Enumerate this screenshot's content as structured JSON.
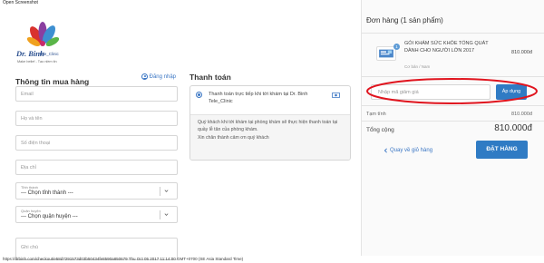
{
  "browser": {
    "caption": "Open Screenshot",
    "status_url": "https://drbinh.com/checkout/e58d7291573d03b50434fe8590a850679 Thu Oct 05 2017 11:14:00 GMT+0700 (SE Asia Standard Time)"
  },
  "brand": {
    "name": "Dr. Binh",
    "sub": "Tele_Clinic",
    "tagline": "Make belief - Tạo niềm tin",
    "logo_icon": "flower-petals-logo-icon"
  },
  "customer_info": {
    "title": "Thông tin mua hàng",
    "login_label": "Đăng nhập",
    "login_icon": "user-circle-icon",
    "fields": {
      "email_placeholder": "Email",
      "name_placeholder": "Họ và tên",
      "phone_placeholder": "Số điện thoại",
      "address_placeholder": "Địa chỉ",
      "note_placeholder": "Ghi chú"
    },
    "province": {
      "label": "Tỉnh thành",
      "value": "--- Chọn tỉnh thành ---"
    },
    "district": {
      "label": "Quận huyện",
      "value": "--- Chọn quận huyện ---"
    }
  },
  "payment": {
    "title": "Thanh toán",
    "option_label": "Thanh toán trực tiếp khi tới khám tại Dr. Binh Tele_Clinic",
    "option_icon": "cash-icon",
    "description_1": "Quý khách khi tới khám tại phòng khám sẽ thực hiện thanh toán tại quầy lễ tân của phòng khám.",
    "description_2": "Xin chân thành cảm ơn quý khách"
  },
  "order_summary": {
    "title": "Đơn hàng (1 sản phẩm)",
    "item": {
      "quantity": "1",
      "name": "GÓI KHÁM SỨC KHỎE TỔNG QUÁT DÀNH CHO NGƯỜI LỚN 2017",
      "variant": "Cơ bản / Nam",
      "price": "810.000đ"
    },
    "discount_placeholder": "Nhập mã giảm giá",
    "apply_label": "Áp dụng",
    "subtotal_label": "Tạm tính",
    "subtotal_value": "810.000đ",
    "total_label": "Tổng cộng",
    "total_value": "810.000đ",
    "back_label": "Quay về giỏ hàng",
    "order_button": "ĐẶT HÀNG",
    "annotation_color": "#e0141e",
    "accent_color": "#2f7bc4"
  }
}
